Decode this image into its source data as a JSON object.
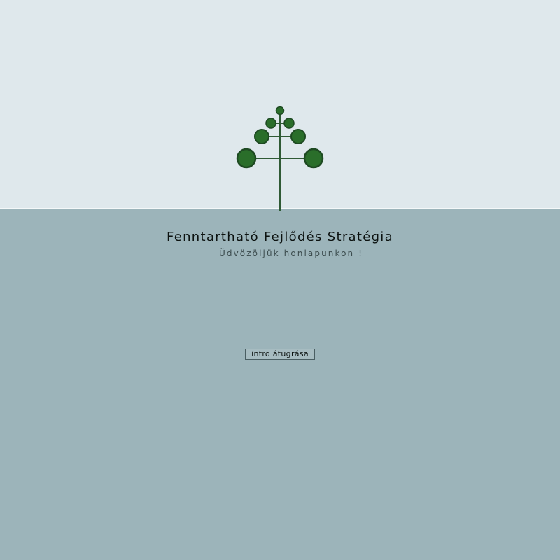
{
  "site": {
    "title": "Fenntartható Fejlődés Stratégia",
    "welcome": "Üdvözöljük honlapunkon !"
  },
  "actions": {
    "skip_intro_label": "intro átugrása"
  },
  "colors": {
    "top_background": "#dfe8ec",
    "bottom_background": "#9cb4ba",
    "logo_green": "#2a6e2a",
    "logo_outline": "#1e4a22"
  },
  "icons": {
    "logo": "tree-icon"
  }
}
